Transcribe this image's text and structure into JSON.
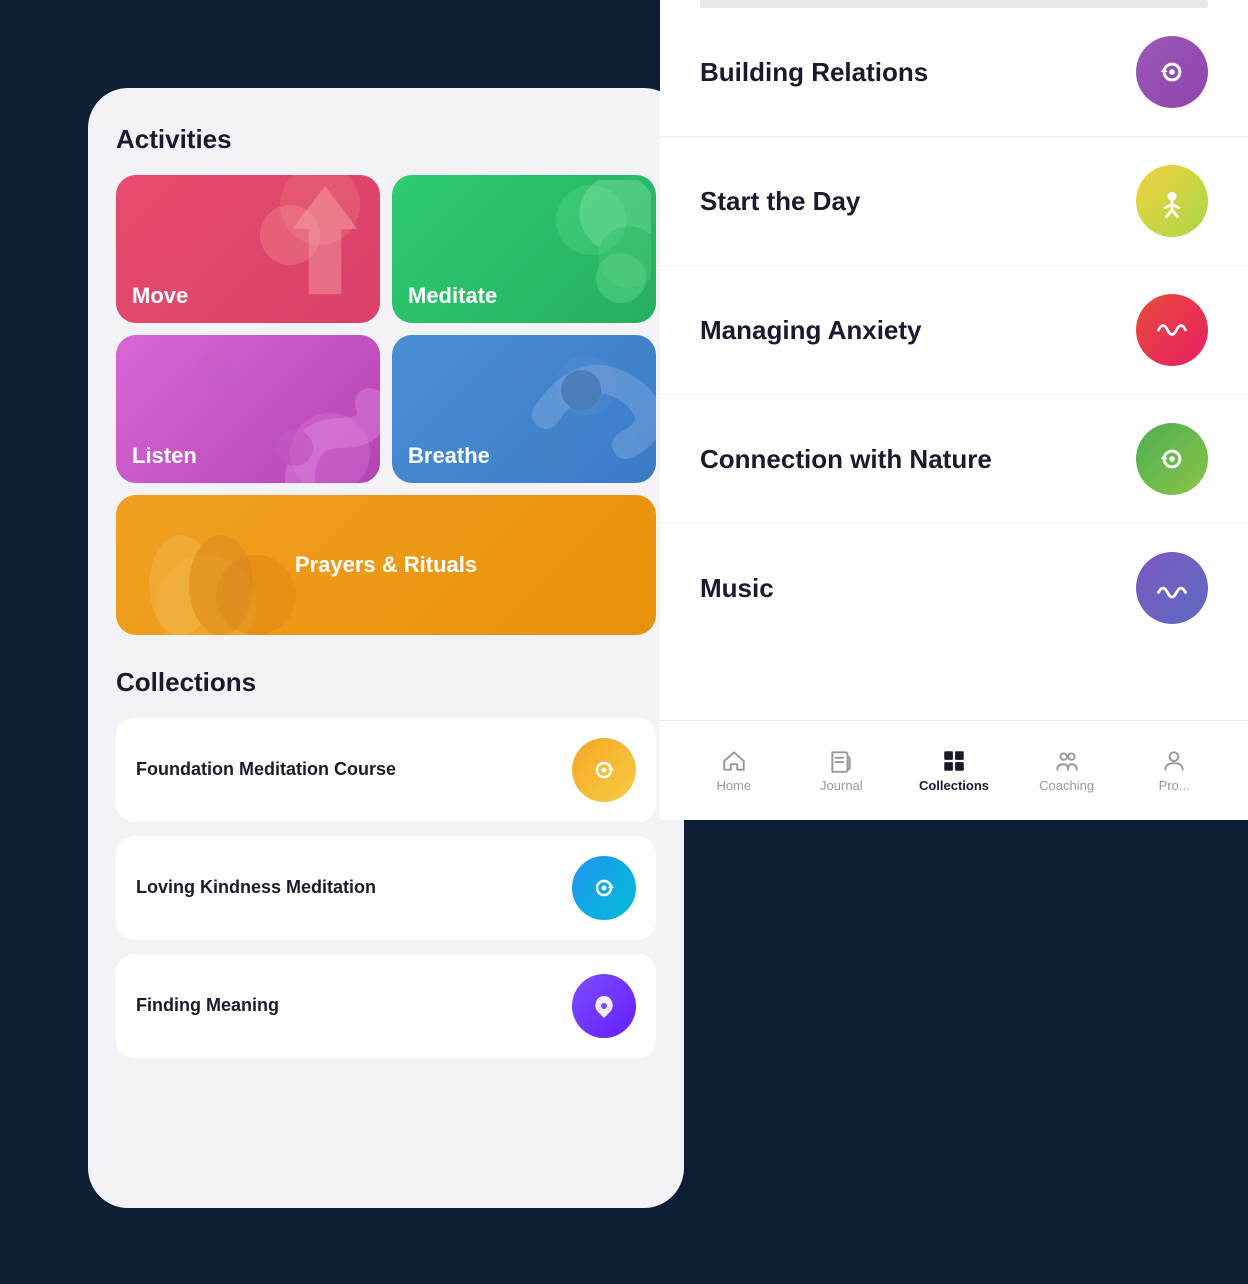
{
  "background_color": "#0d1f35",
  "left_panel": {
    "activities_title": "Activities",
    "activity_cards": [
      {
        "id": "move",
        "label": "Move",
        "color_class": "card-move"
      },
      {
        "id": "meditate",
        "label": "Meditate",
        "color_class": "card-meditate"
      },
      {
        "id": "listen",
        "label": "Listen",
        "color_class": "card-listen"
      },
      {
        "id": "breathe",
        "label": "Breathe",
        "color_class": "card-breathe"
      }
    ],
    "prayers_label": "Prayers & Rituals",
    "collections_title": "Collections",
    "collection_items": [
      {
        "id": "foundation",
        "title": "Foundation Meditation Course",
        "icon_class": "icon-orange-yellow"
      },
      {
        "id": "loving",
        "title": "Loving Kindness Meditation",
        "icon_class": "icon-blue-teal"
      },
      {
        "id": "meaning",
        "title": "Finding Meaning",
        "icon_class": "icon-purple-indigo"
      }
    ]
  },
  "right_panel": {
    "list_items": [
      {
        "id": "building",
        "title": "Building Relations",
        "icon_class": "icon-purple"
      },
      {
        "id": "start",
        "title": "Start the Day",
        "icon_class": "icon-yellow-green"
      },
      {
        "id": "anxiety",
        "title": "Managing Anxiety",
        "icon_class": "icon-red-pink"
      },
      {
        "id": "nature",
        "title": "Connection with Nature",
        "icon_class": "icon-green"
      },
      {
        "id": "music",
        "title": "Music",
        "icon_class": "icon-purple-blue"
      }
    ]
  },
  "bottom_nav": {
    "items": [
      {
        "id": "home",
        "label": "Home",
        "active": false
      },
      {
        "id": "journal",
        "label": "Journal",
        "active": false
      },
      {
        "id": "collections",
        "label": "Collections",
        "active": true
      },
      {
        "id": "coaching",
        "label": "Coaching",
        "active": false
      },
      {
        "id": "profile",
        "label": "Pro...",
        "active": false
      }
    ]
  }
}
